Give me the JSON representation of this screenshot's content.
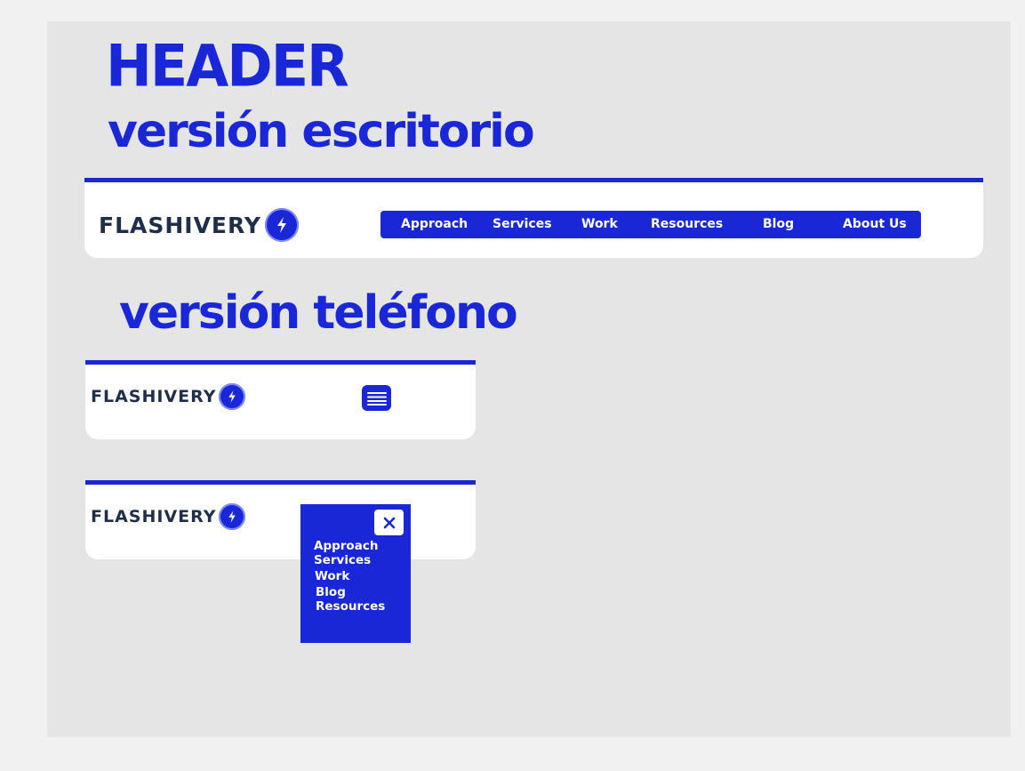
{
  "headings": {
    "header": "HEADER",
    "desktop": "versión escritorio",
    "phone": "versión teléfono"
  },
  "brand": {
    "name": "FLASHIVERY",
    "logo_icon": "lightning-bolt-icon"
  },
  "desktop_nav": {
    "items": [
      "Approach",
      "Services",
      "Work",
      "Resources",
      "Blog",
      "About Us"
    ]
  },
  "phone": {
    "menu_icon": "hamburger-menu-icon",
    "close_icon": "close-icon",
    "menu_items": [
      "Approach",
      "Services",
      "Work",
      "Blog",
      "Resources"
    ]
  },
  "colors": {
    "accent": "#1a27d6",
    "logo_text": "#1f2f4a",
    "card": "#ffffff",
    "canvas": "#e5e5e5",
    "page": "#f1f1f1"
  }
}
